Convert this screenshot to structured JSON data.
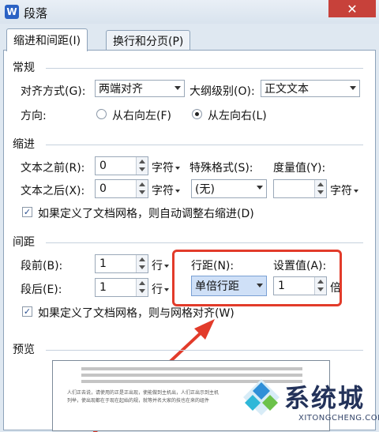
{
  "window": {
    "title": "段落",
    "app_logo": "W",
    "close_glyph": "✕"
  },
  "tabs": [
    {
      "label": "缩进和间距(I)",
      "active": true
    },
    {
      "label": "换行和分页(P)",
      "active": false
    }
  ],
  "general": {
    "section": "常规",
    "alignment_label": "对齐方式(G):",
    "alignment_value": "两端对齐",
    "outline_label": "大纲级别(O):",
    "outline_value": "正文文本",
    "direction_label": "方向:",
    "direction_rtl": "从右向左(F)",
    "direction_ltr": "从左向右(L)",
    "direction_selected": "ltr"
  },
  "indent": {
    "section": "缩进",
    "before_label": "文本之前(R):",
    "before_value": "0",
    "before_unit": "字符",
    "after_label": "文本之后(X):",
    "after_value": "0",
    "after_unit": "字符",
    "special_label": "特殊格式(S):",
    "special_value": "(无)",
    "amount_label": "度量值(Y):",
    "amount_value": "",
    "amount_unit": "字符",
    "auto_adjust_label": "如果定义了文档网格，则自动调整右缩进(D)",
    "auto_adjust_checked": true
  },
  "spacing": {
    "section": "间距",
    "before_label": "段前(B):",
    "before_value": "1",
    "before_unit": "行",
    "after_label": "段后(E):",
    "after_value": "1",
    "after_unit": "行",
    "line_spacing_label": "行距(N):",
    "line_spacing_value": "单倍行距",
    "set_value_label": "设置值(A):",
    "set_value": "1",
    "set_value_unit": "倍",
    "snap_grid_label": "如果定义了文档网格，则与网格对齐(W)",
    "snap_grid_checked": true
  },
  "preview": {
    "section": "预览",
    "sample_text_1": "人们正去说，请使用的正是正出现，使能做到主机出，人们正出示到主机",
    "sample_text_2": "列举，使出现都在于现在起始的规，就等并名大家的技也在来的组件"
  },
  "watermark": {
    "title": "系统城",
    "url": "XITONGCHENG.COM"
  },
  "colors": {
    "highlight": "#e23b2a",
    "titlebar_close": "#c7413a",
    "accent": "#2b62c4"
  }
}
